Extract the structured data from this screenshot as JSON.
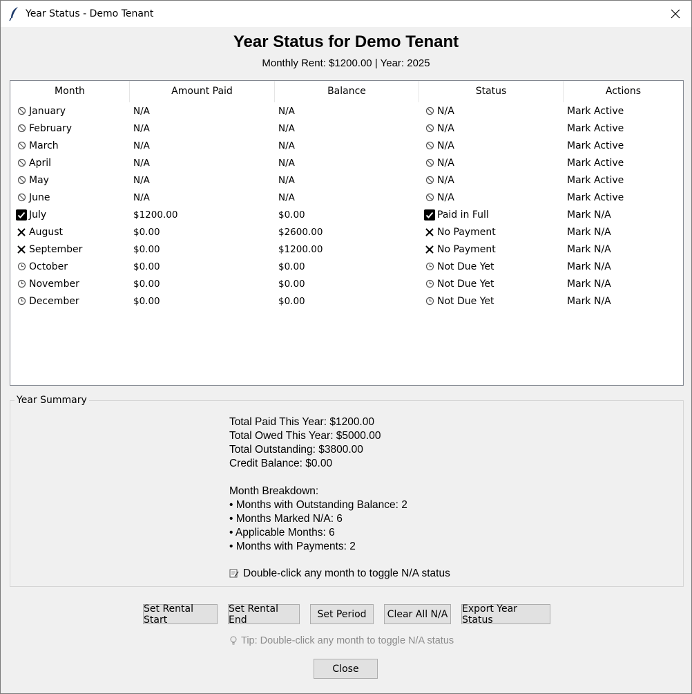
{
  "window": {
    "title": "Year Status - Demo Tenant"
  },
  "header": {
    "title": "Year Status for Demo Tenant",
    "subtitle": "Monthly Rent: $1200.00 | Year: 2025"
  },
  "table": {
    "columns": [
      "Month",
      "Amount Paid",
      "Balance",
      "Status",
      "Actions"
    ],
    "rows": [
      {
        "icon": "na-icon",
        "month": "January",
        "paid": "N/A",
        "balance": "N/A",
        "status_icon": "na-icon",
        "status": "N/A",
        "action": "Mark Active"
      },
      {
        "icon": "na-icon",
        "month": "February",
        "paid": "N/A",
        "balance": "N/A",
        "status_icon": "na-icon",
        "status": "N/A",
        "action": "Mark Active"
      },
      {
        "icon": "na-icon",
        "month": "March",
        "paid": "N/A",
        "balance": "N/A",
        "status_icon": "na-icon",
        "status": "N/A",
        "action": "Mark Active"
      },
      {
        "icon": "na-icon",
        "month": "April",
        "paid": "N/A",
        "balance": "N/A",
        "status_icon": "na-icon",
        "status": "N/A",
        "action": "Mark Active"
      },
      {
        "icon": "na-icon",
        "month": "May",
        "paid": "N/A",
        "balance": "N/A",
        "status_icon": "na-icon",
        "status": "N/A",
        "action": "Mark Active"
      },
      {
        "icon": "na-icon",
        "month": "June",
        "paid": "N/A",
        "balance": "N/A",
        "status_icon": "na-icon",
        "status": "N/A",
        "action": "Mark Active"
      },
      {
        "icon": "check-icon",
        "month": "July",
        "paid": "$1200.00",
        "balance": "$0.00",
        "status_icon": "check-icon",
        "status": "Paid in Full",
        "action": "Mark N/A"
      },
      {
        "icon": "cross-icon",
        "month": "August",
        "paid": "$0.00",
        "balance": "$2600.00",
        "status_icon": "cross-icon",
        "status": "No Payment",
        "action": "Mark N/A"
      },
      {
        "icon": "cross-icon",
        "month": "September",
        "paid": "$0.00",
        "balance": "$1200.00",
        "status_icon": "cross-icon",
        "status": "No Payment",
        "action": "Mark N/A"
      },
      {
        "icon": "clock-icon",
        "month": "October",
        "paid": "$0.00",
        "balance": "$0.00",
        "status_icon": "clock-icon",
        "status": "Not Due Yet",
        "action": "Mark N/A"
      },
      {
        "icon": "clock-icon",
        "month": "November",
        "paid": "$0.00",
        "balance": "$0.00",
        "status_icon": "clock-icon",
        "status": "Not Due Yet",
        "action": "Mark N/A"
      },
      {
        "icon": "clock-icon",
        "month": "December",
        "paid": "$0.00",
        "balance": "$0.00",
        "status_icon": "clock-icon",
        "status": "Not Due Yet",
        "action": "Mark N/A"
      }
    ]
  },
  "summary": {
    "legend": "Year Summary",
    "lines": [
      "Total Paid This Year: $1200.00",
      "Total Owed This Year: $5000.00",
      "Total Outstanding: $3800.00",
      "Credit Balance: $0.00",
      "",
      "Month Breakdown:",
      "• Months with Outstanding Balance: 2",
      "• Months Marked N/A: 6",
      "• Applicable Months: 6",
      "• Months with Payments: 2"
    ],
    "hint": "Double-click any month to toggle N/A status"
  },
  "buttons": {
    "set_rental_start": "Set Rental Start",
    "set_rental_end": "Set Rental End",
    "set_period": "Set Period",
    "clear_all_na": "Clear All N/A",
    "export_year_status": "Export Year Status",
    "close": "Close"
  },
  "tip": "Tip: Double-click any month to toggle N/A status"
}
